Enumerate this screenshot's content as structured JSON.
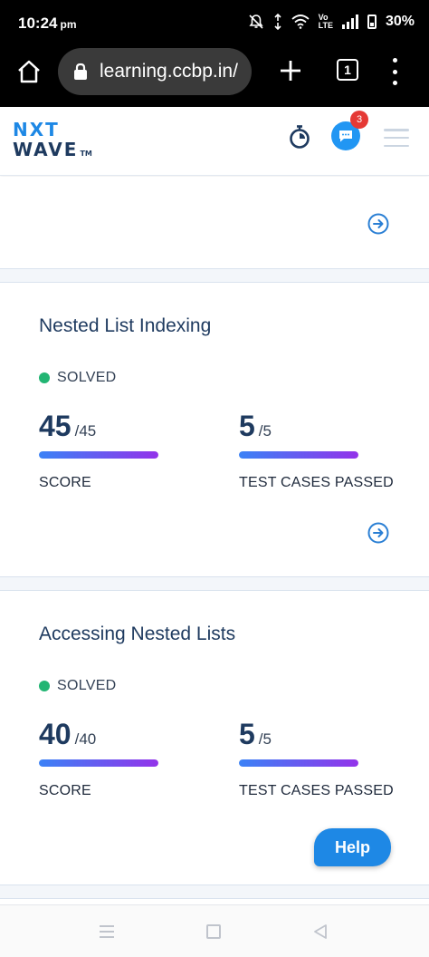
{
  "status_bar": {
    "time": "10:24",
    "ampm": "pm",
    "lte_top": "Vo",
    "lte_bottom": "LTE",
    "battery": "30%"
  },
  "browser": {
    "url": "learning.ccbp.in/",
    "tab_count": "1"
  },
  "header": {
    "logo_line1": "NXT",
    "logo_line2": "WAVE",
    "logo_tm": "TM",
    "chat_badge_count": "3"
  },
  "questions": [
    {
      "title": "Nested List Indexing",
      "status": "SOLVED",
      "score": "45",
      "score_max": "/45",
      "score_label": "SCORE",
      "score_fraction": 1.0,
      "tests": "5",
      "tests_max": "/5",
      "tests_label": "TEST CASES PASSED",
      "tests_fraction": 1.0
    },
    {
      "title": "Accessing Nested Lists",
      "status": "SOLVED",
      "score": "40",
      "score_max": "/40",
      "score_label": "SCORE",
      "score_fraction": 1.0,
      "tests": "5",
      "tests_max": "/5",
      "tests_label": "TEST CASES PASSED",
      "tests_fraction": 1.0
    }
  ],
  "help_button": "Help",
  "colors": {
    "accent": "#1e88e5",
    "title": "#1e3a5f",
    "solved": "#22b573",
    "bar_start": "#3b82f6",
    "bar_end": "#9333ea",
    "badge": "#e53935"
  }
}
